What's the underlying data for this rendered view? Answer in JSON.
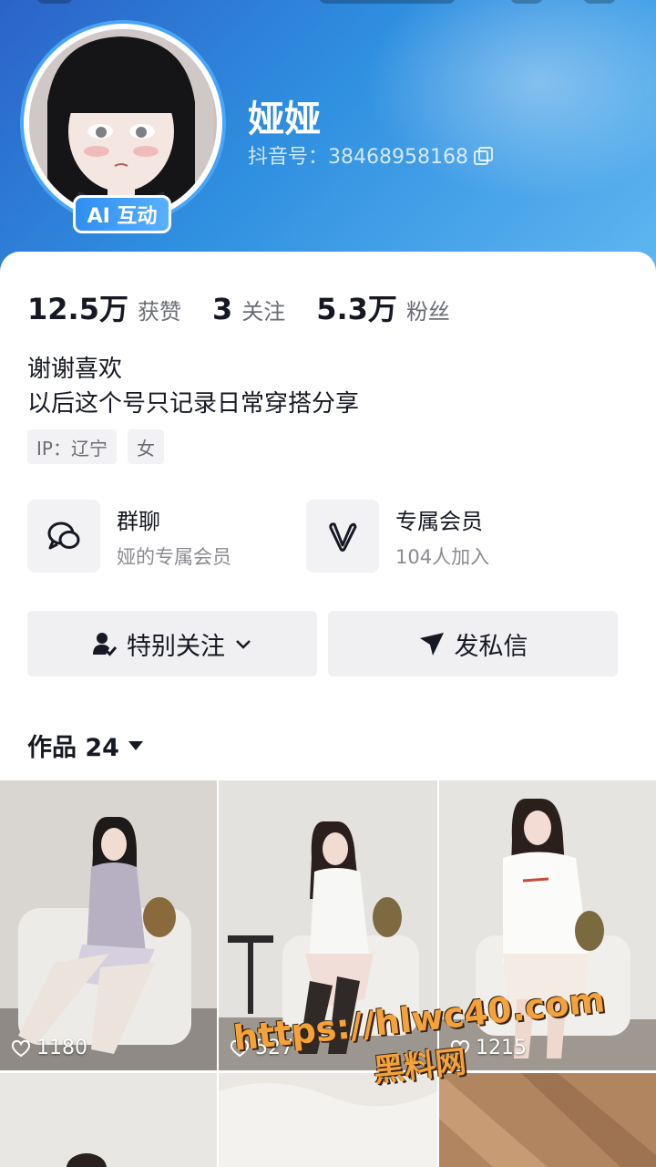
{
  "profile": {
    "name": "娅娅",
    "douyin_id": "抖音号：38468958168",
    "ai_badge": "AI 互动",
    "accent": "#2f8fe0"
  },
  "stats": [
    {
      "value": "12.5万",
      "label": "获赞"
    },
    {
      "value": "3",
      "label": "关注"
    },
    {
      "value": "5.3万",
      "label": "粉丝"
    }
  ],
  "bio": {
    "line1": "谢谢喜欢",
    "line2": "以后这个号只记录日常穿搭分享"
  },
  "tags": [
    "IP：辽宁",
    "女"
  ],
  "entries": [
    {
      "icon": "group-chat-icon",
      "title": "群聊",
      "subtitle": "娅的专属会员"
    },
    {
      "icon": "heart-v-icon",
      "title": "专属会员",
      "subtitle": "104人加入"
    }
  ],
  "actions": {
    "follow_label": "特别关注",
    "message_label": "发私信"
  },
  "works": {
    "title": "作品 24",
    "items": [
      {
        "likes": "1180"
      },
      {
        "likes": "527"
      },
      {
        "likes": "1215"
      }
    ]
  },
  "watermark": {
    "url": "https://hlwc40.com",
    "name": "黑料网"
  }
}
